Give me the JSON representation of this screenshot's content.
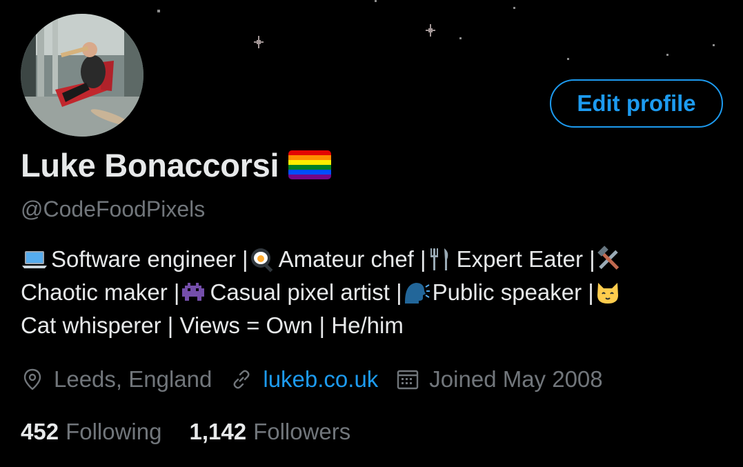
{
  "profile": {
    "name": "Luke Bonaccorsi",
    "handle": "@CodeFoodPixels",
    "edit_label": "Edit profile",
    "flag_icon": "rainbow-flag-icon",
    "avatar_icon": "profile-photo"
  },
  "bio": {
    "line1": {
      "seg1": "Software engineer | ",
      "seg2": "Amateur chef | ",
      "seg3": "Expert Eater | "
    },
    "line2": {
      "seg1": "Chaotic maker | ",
      "seg2": "Casual pixel artist | ",
      "seg3": "Public speaker | "
    },
    "line3": "Cat whisperer | Views = Own | He/him",
    "icons": [
      "laptop-icon",
      "frying-pan-egg-icon",
      "fork-knife-icon",
      "hammer-wrench-icon",
      "space-invader-icon",
      "speaking-head-icon",
      "cat-face-icon"
    ]
  },
  "meta": {
    "location": "Leeds, England",
    "website": "lukeb.co.uk",
    "joined": "Joined May 2008"
  },
  "stats": {
    "following_count": "452",
    "following_label": "Following",
    "followers_count": "1,142",
    "followers_label": "Followers"
  },
  "colors": {
    "background": "#000000",
    "accent": "#1d9bf0",
    "text_primary": "#e7e9ea",
    "text_secondary": "#71767b"
  }
}
